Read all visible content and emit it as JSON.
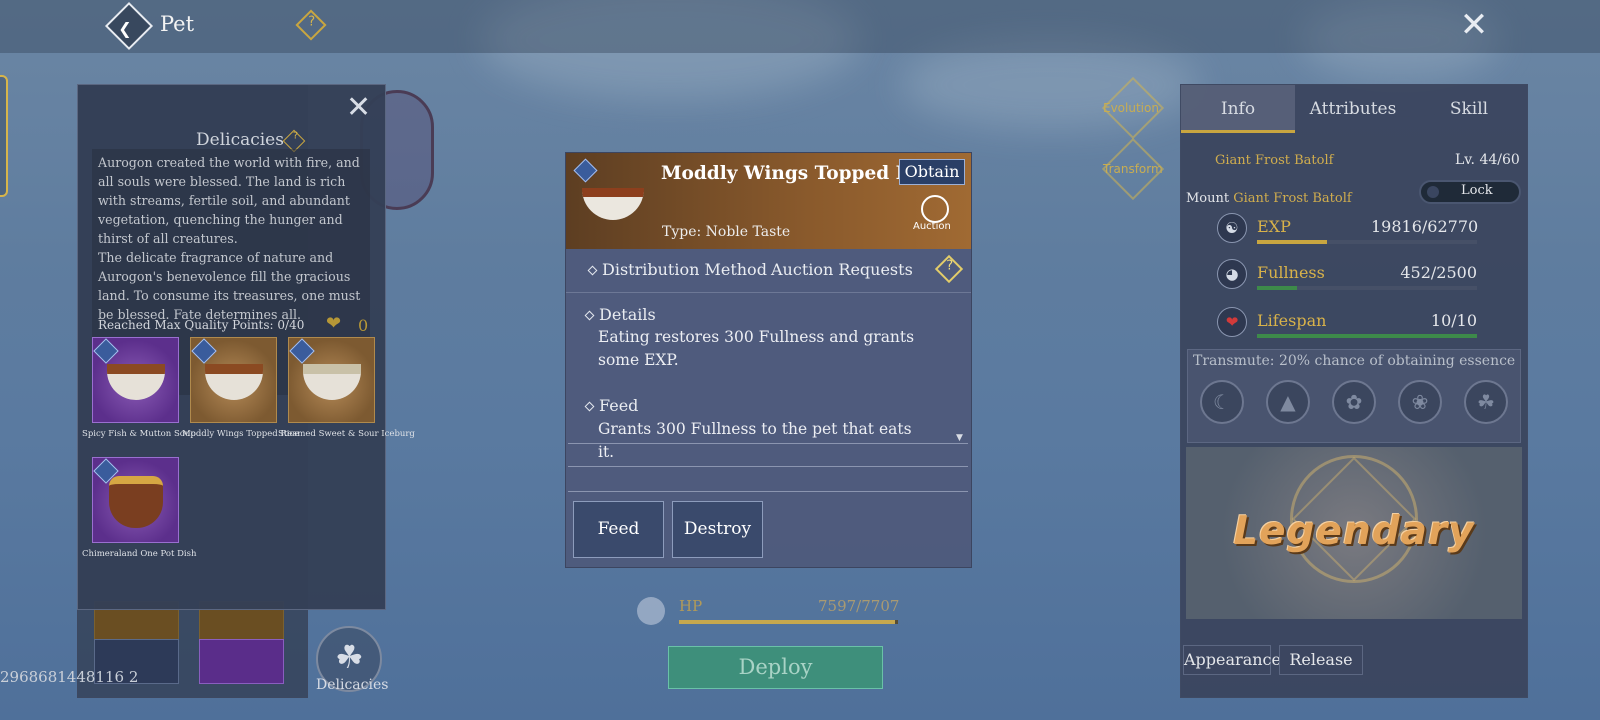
{
  "header": {
    "title": "Pet",
    "help_glyph": "?"
  },
  "uid": "2968681448116 2",
  "delicacies_button": {
    "label": "Delicacies"
  },
  "popup": {
    "title": "Delicacies",
    "lore_p1": "Aurogon created the world with fire, and all souls were blessed. The land is rich with streams, fertile soil, and abundant vegetation, quenching the hunger and thirst of all creatures.",
    "lore_p2": "The delicate fragrance of nature and Aurogon's benevolence fill the gracious land. To consume its treasures, one must be blessed. Fate determines all.",
    "max_points": "Reached Max Quality Points: 0/40",
    "heart_count": "0",
    "foods": [
      {
        "label": "Spicy Fish & Mutton Soup",
        "rarity": "purple"
      },
      {
        "label": "Moddly Wings Topped Rice",
        "rarity": "gold"
      },
      {
        "label": "Steamed Sweet & Sour Iceburg",
        "rarity": "gold"
      },
      {
        "label": "Chimeraland One Pot Dish",
        "rarity": "purple"
      }
    ]
  },
  "item": {
    "name": "Moddly Wings Topped Rice",
    "obtain": "Obtain",
    "auction_label": "Auction",
    "type": "Type: Noble Taste",
    "dist_label": "Distribution Method",
    "dist_value": "Auction Requests",
    "details_title": "Details",
    "details_text": "Eating restores 300 Fullness and grants some EXP.",
    "feed_title": "Feed",
    "feed_text": "Grants 300 Fullness to the pet that eats it.",
    "feed_button": "Feed",
    "destroy_button": "Destroy"
  },
  "hp": {
    "label": "HP",
    "value": "7597/7707",
    "fraction": 0.986
  },
  "deploy": "Deploy",
  "side": {
    "evolution": "Evolution",
    "transform": "Transform"
  },
  "info": {
    "tabs": [
      "Info",
      "Attributes",
      "Skill"
    ],
    "pet_name": "Giant Frost Batolf",
    "level": "Lv. 44/60",
    "mount_label": "Mount",
    "mount_name": "Giant Frost Batolf",
    "lock": "Lock",
    "stats": [
      {
        "name": "EXP",
        "value": "19816/62770",
        "fraction": 0.316,
        "color": "#c9a640"
      },
      {
        "name": "Fullness",
        "value": "452/2500",
        "fraction": 0.181,
        "color": "#3d8a4a"
      },
      {
        "name": "Lifespan",
        "value": "10/10",
        "fraction": 1.0,
        "color": "#3d8a4a"
      }
    ],
    "transmute": "Transmute: 20% chance of obtaining essence",
    "rarity": "Legendary",
    "appearance": "Appearance",
    "release": "Release"
  }
}
